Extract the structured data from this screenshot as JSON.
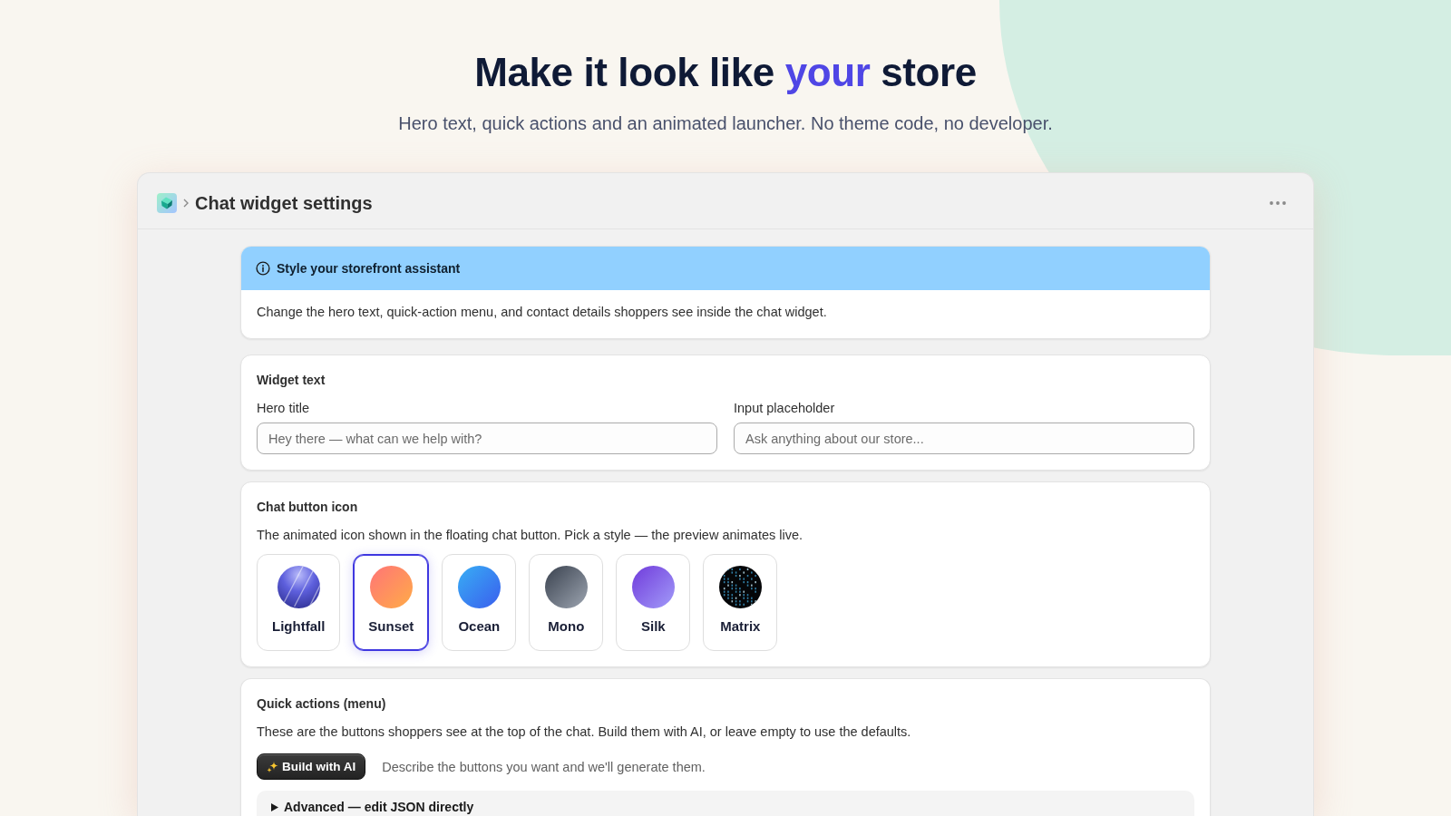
{
  "hero": {
    "title_parts": [
      {
        "text": "Make it look like ",
        "accent": false
      },
      {
        "text": "your",
        "accent": true
      },
      {
        "text": " store",
        "accent": false
      }
    ],
    "subtitle": "Hero text, quick actions and an animated launcher. No theme code, no developer."
  },
  "window": {
    "title": "Chat widget settings"
  },
  "banner": {
    "title": "Style your storefront assistant",
    "body": "Change the hero text, quick-action menu, and contact details shoppers see inside the chat widget."
  },
  "widget_text": {
    "title": "Widget text",
    "fields": [
      {
        "label": "Hero title",
        "placeholder": "Hey there — what can we help with?"
      },
      {
        "label": "Input placeholder",
        "placeholder": "Ask anything about our store..."
      }
    ]
  },
  "chat_button_icon": {
    "title": "Chat button icon",
    "description": "The animated icon shown in the floating chat button. Pick a style — the preview animates live.",
    "styles": [
      {
        "label": "Lightfall",
        "kind": "lightfall",
        "selected": false
      },
      {
        "label": "Sunset",
        "kind": "sunset",
        "selected": true
      },
      {
        "label": "Ocean",
        "kind": "ocean",
        "selected": false
      },
      {
        "label": "Mono",
        "kind": "mono",
        "selected": false
      },
      {
        "label": "Silk",
        "kind": "silk",
        "selected": false
      },
      {
        "label": "Matrix",
        "kind": "matrix",
        "selected": false
      }
    ]
  },
  "quick_actions": {
    "title": "Quick actions (menu)",
    "description": "These are the buttons shoppers see at the top of the chat. Build them with AI, or leave empty to use the defaults.",
    "build_button": "Build with AI",
    "hint": "Describe the buttons you want and we'll generate them.",
    "advanced": {
      "label": "Advanced — edit JSON directly",
      "expanded": false
    }
  }
}
